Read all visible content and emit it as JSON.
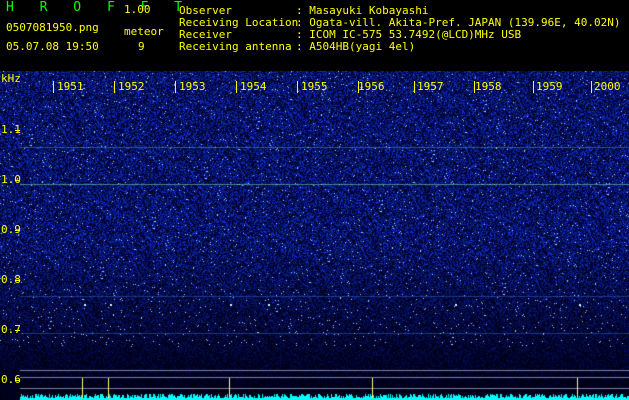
{
  "app": {
    "logo": "H R O F F T",
    "version": "1.00"
  },
  "file": {
    "name": "0507081950.png",
    "date_time": "05.07.08 19:50"
  },
  "meteor": {
    "label": "meteor",
    "count": "9"
  },
  "info": [
    {
      "key": "Observer",
      "value": ": Masayuki Kobayashi"
    },
    {
      "key": "Receiving Location",
      "value": ": Ogata-vill. Akita-Pref. JAPAN (139.96E, 40.02N)"
    },
    {
      "key": "Receiver",
      "value": ": ICOM IC-575 53.7492(@LCD)MHz USB"
    },
    {
      "key": "Receiving antenna",
      "value": ": A504HB(yagi 4el)"
    }
  ],
  "y_axis": {
    "unit": "kHz",
    "ticks": [
      "1.1",
      "1.0",
      "0.9",
      "0.8",
      "0.7",
      "0.6"
    ]
  },
  "time_axis": {
    "ticks": [
      "1951",
      "1952",
      "1953",
      "1954",
      "1955",
      "1956",
      "1957",
      "1958",
      "1959",
      "2000"
    ]
  },
  "colors": {
    "background": "#000000",
    "accent_green": "#00ff00",
    "label_yellow": "#ffff00",
    "signal_cyan": "#00ffff",
    "noise_blue": "#1a2fc8"
  }
}
